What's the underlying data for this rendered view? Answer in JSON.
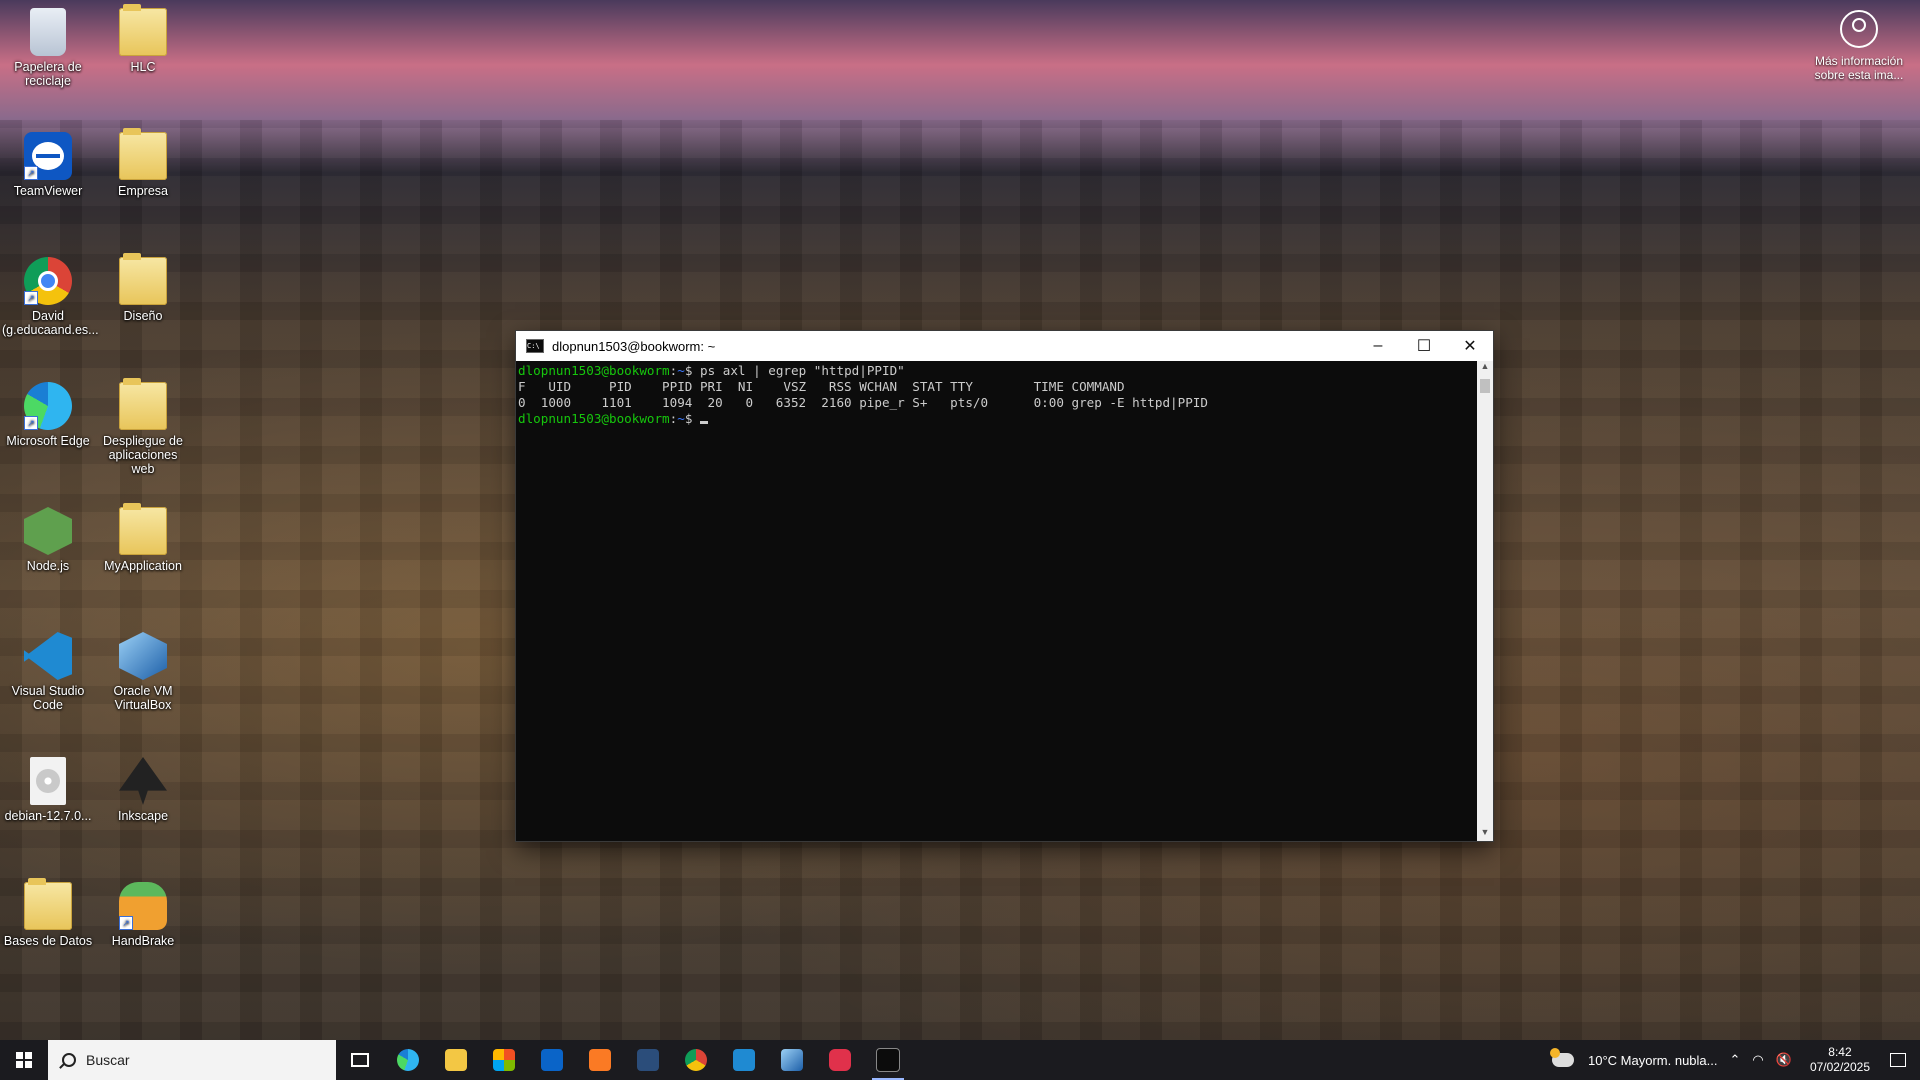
{
  "desktop": {
    "icons": [
      {
        "label": "Papelera de reciclaje",
        "icon": "recycle-bin-icon"
      },
      {
        "label": "HLC",
        "icon": "folder-icon"
      },
      {
        "label": "TeamViewer",
        "icon": "teamviewer-icon"
      },
      {
        "label": "Empresa",
        "icon": "folder-icon"
      },
      {
        "label": "David (g.educaand.es...",
        "icon": "chrome-icon"
      },
      {
        "label": "Diseño",
        "icon": "folder-icon"
      },
      {
        "label": "Microsoft Edge",
        "icon": "edge-icon"
      },
      {
        "label": "Despliegue de aplicaciones web",
        "icon": "folder-icon"
      },
      {
        "label": "Node.js",
        "icon": "nodejs-icon"
      },
      {
        "label": "MyApplication",
        "icon": "folder-icon"
      },
      {
        "label": "Visual Studio Code",
        "icon": "vscode-icon"
      },
      {
        "label": "Oracle VM VirtualBox",
        "icon": "virtualbox-icon"
      },
      {
        "label": "debian-12.7.0...",
        "icon": "disc-image-icon"
      },
      {
        "label": "Inkscape",
        "icon": "inkscape-icon"
      },
      {
        "label": "Bases de Datos",
        "icon": "folder-icon"
      },
      {
        "label": "HandBrake",
        "icon": "handbrake-icon"
      }
    ],
    "info_button": "Más información sobre esta ima..."
  },
  "terminal": {
    "title": "dlopnun1503@bookworm: ~",
    "prompt_user": "dlopnun1503@bookworm",
    "prompt_path": "~",
    "command": "ps axl | egrep \"httpd|PPID\"",
    "header_line": "F   UID     PID    PPID PRI  NI    VSZ   RSS WCHAN  STAT TTY        TIME COMMAND",
    "row_line": "0  1000    1101    1094  20   0   6352  2160 pipe_r S+   pts/0      0:00 grep -E httpd|PPID"
  },
  "taskbar": {
    "search_placeholder": "Buscar",
    "apps": [
      "task-view",
      "edge",
      "file-explorer",
      "store",
      "outlook",
      "xampp",
      "sql-developer",
      "chrome",
      "vscode",
      "virtualbox",
      "screen-recorder",
      "terminal"
    ],
    "weather": "10°C  Mayorm. nubla...",
    "time": "8:42",
    "date": "07/02/2025"
  },
  "colors": {
    "prompt_green": "#16c60c",
    "prompt_blue": "#3b78ff",
    "terminal_bg": "#0c0c0c"
  }
}
